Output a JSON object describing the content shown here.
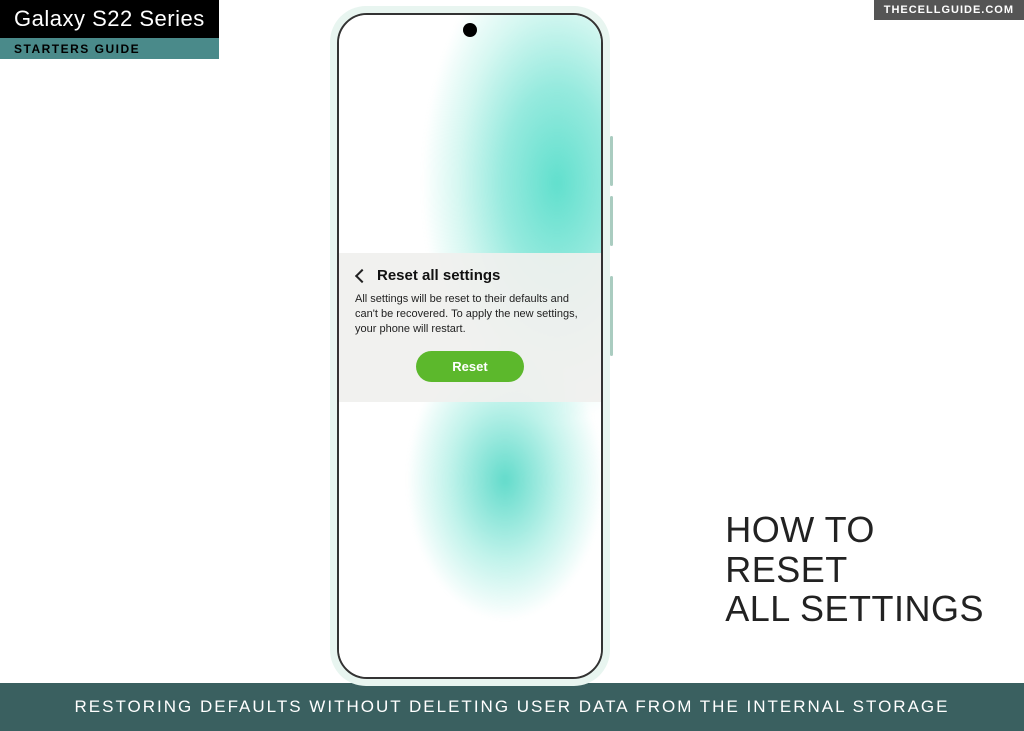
{
  "badge": {
    "series": "Galaxy S22 Series",
    "guide": "STARTERS GUIDE"
  },
  "site": "THECELLGUIDE.COM",
  "panel": {
    "title": "Reset all settings",
    "body": "All settings will be reset to their defaults and can't be recovered. To apply the new settings, your phone will restart.",
    "button": "Reset"
  },
  "headline": {
    "line1": "HOW TO",
    "line2": "RESET",
    "line3": "ALL SETTINGS"
  },
  "footer": "RESTORING DEFAULTS WITHOUT DELETING USER DATA FROM THE INTERNAL STORAGE"
}
